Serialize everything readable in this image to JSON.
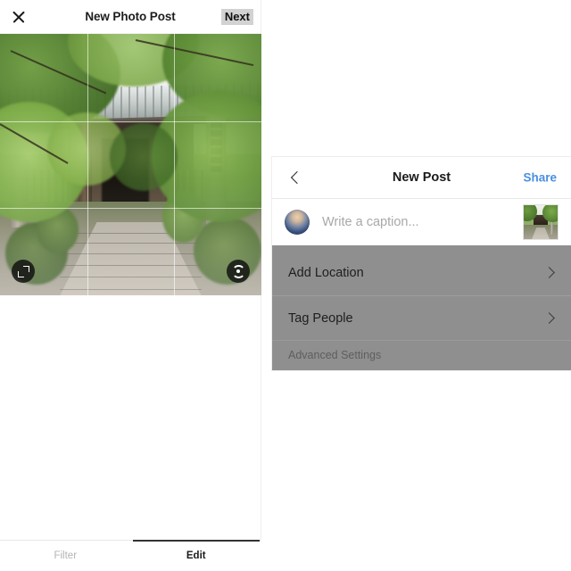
{
  "editor": {
    "header": {
      "close_icon": "close-icon",
      "title": "New Photo Post",
      "next_label": "Next"
    },
    "photo": {
      "alt": "Japanese temple gate with tiled roof, stone steps and green trees",
      "expand_icon": "expand-icon",
      "rotate_icon": "rotate-icon",
      "crop_grid": "visible"
    },
    "tabs": [
      {
        "label": "Filter",
        "active": false
      },
      {
        "label": "Edit",
        "active": true
      }
    ]
  },
  "new_post": {
    "header": {
      "back_icon": "chevron-left-icon",
      "title": "New Post",
      "share_label": "Share",
      "share_color": "#4a90e2"
    },
    "caption": {
      "placeholder": "Write a caption...",
      "value": "",
      "avatar": "user-avatar",
      "thumbnail": "post-thumbnail"
    },
    "options": [
      {
        "label": "Add Location",
        "chevron": "chevron-right-icon"
      },
      {
        "label": "Tag People",
        "chevron": "chevron-right-icon"
      }
    ],
    "advanced": {
      "label": "Advanced Settings"
    },
    "overlay_color": "#8f8f8f"
  }
}
